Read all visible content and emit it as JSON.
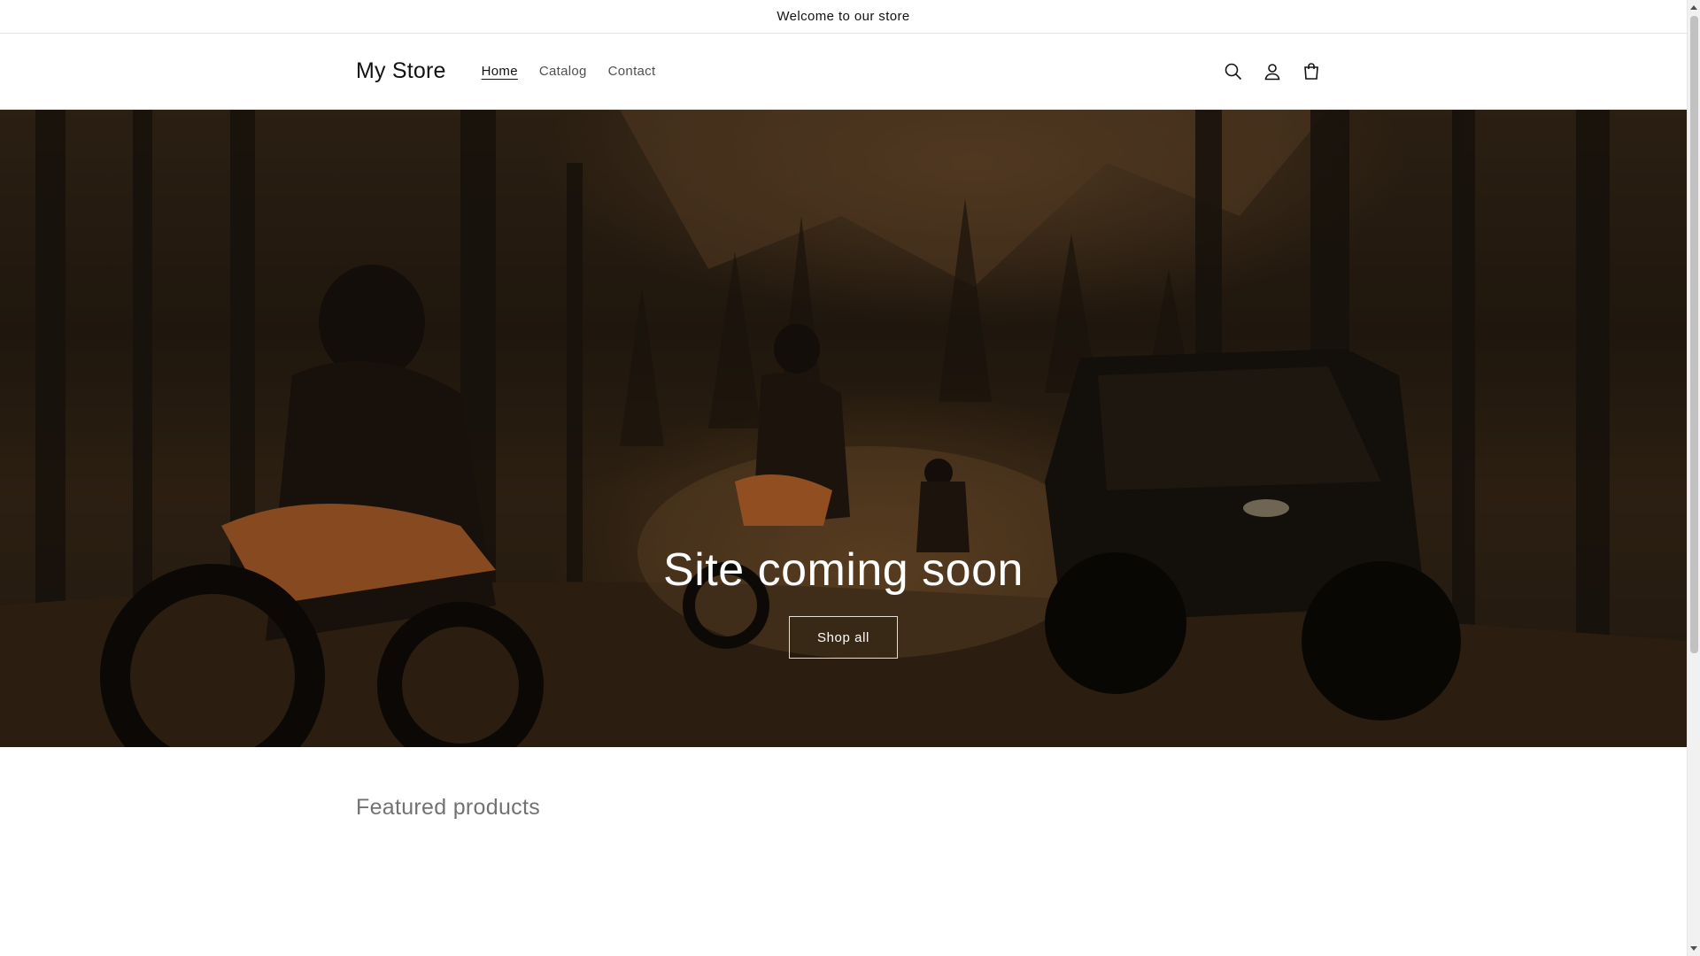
{
  "announcement": {
    "text": "Welcome to our store"
  },
  "header": {
    "logo": "My Store",
    "nav": [
      {
        "label": "Home",
        "active": true
      },
      {
        "label": "Catalog",
        "active": false
      },
      {
        "label": "Contact",
        "active": false
      }
    ],
    "icons": [
      "search-icon",
      "account-icon",
      "cart-icon"
    ]
  },
  "hero": {
    "title": "Site coming soon",
    "button_label": "Shop all"
  },
  "featured": {
    "title": "Featured products"
  },
  "colors": {
    "text": "#121212",
    "border": "#e3e3e3",
    "hero_text": "#ffffff"
  }
}
